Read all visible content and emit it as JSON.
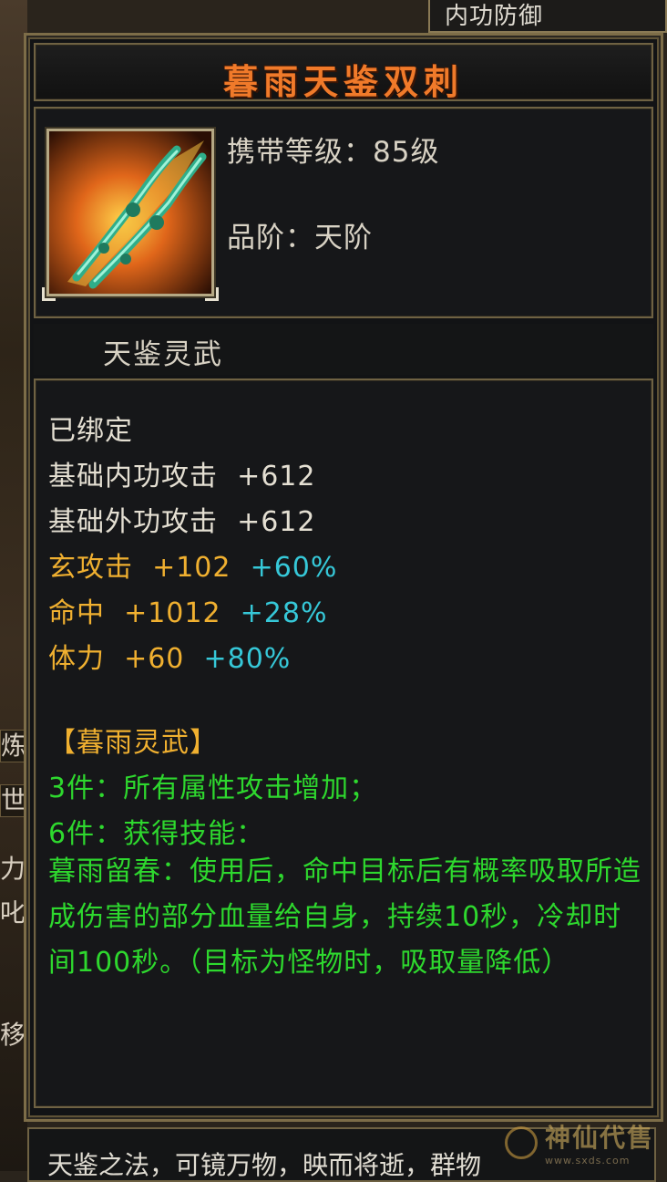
{
  "top_tab": {
    "label": "内功防御"
  },
  "item": {
    "name": "暮雨天鉴双刺",
    "icon": "twin-daggers-icon",
    "carry_level": "携带等级：85级",
    "grade": "品阶：天阶",
    "set_name": "天鉴灵武"
  },
  "attributes": {
    "bound": "已绑定",
    "base": [
      {
        "label": "基础内功攻击",
        "value": "+612"
      },
      {
        "label": "基础外功攻击",
        "value": "+612"
      }
    ],
    "extra": [
      {
        "label": "玄攻击",
        "value": "+102",
        "bonus": "+60%"
      },
      {
        "label": "命中",
        "value": "+1012",
        "bonus": "+28%"
      },
      {
        "label": "体力",
        "value": "+60",
        "bonus": "+80%"
      }
    ]
  },
  "set_bonus": {
    "title": "【暮雨灵武】",
    "piece3": "3件：所有属性攻击增加；",
    "piece6": "6件：获得技能：",
    "skill_desc": "暮雨留春：使用后，命中目标后有概率吸取所造成伤害的部分血量给自身，持续10秒，冷却时间100秒。（目标为怪物时，吸取量降低）"
  },
  "bottom_text": "天鉴之法，可镜万物，映而将逝，群物",
  "left_edge_fragments": [
    "炼",
    "世",
    "力",
    "叱",
    "移"
  ],
  "watermark": {
    "text": "神仙代售",
    "url": "www.sxds.com"
  },
  "colors": {
    "title": "#f07a2a",
    "white_text": "#e4dfd2",
    "gold_text": "#f0b030",
    "cyan_text": "#36c8d8",
    "green_text": "#2ed82e",
    "frame": "#7d6d48"
  }
}
